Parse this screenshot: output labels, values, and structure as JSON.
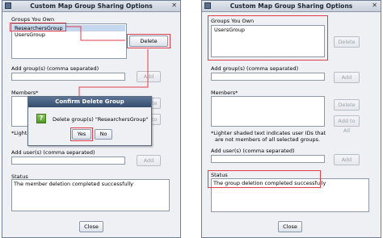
{
  "left": {
    "title": "Custom Map Group Sharing Options",
    "groups_label": "Groups You Own",
    "groups": [
      "ResearchersGroup",
      "UsersGroup"
    ],
    "delete_label": "Delete",
    "add_groups_label": "Add group(s) (comma separated)",
    "add_label": "Add",
    "members_label": "Members*",
    "delete2_label": "Delete",
    "add_to_all_label": "Add to All",
    "lighter_note_start": "*Lighter",
    "add_users_label": "Add user(s) (comma separated)",
    "add2_label": "Add",
    "status_label": "Status",
    "status_text": "The member deletion completed successfully",
    "close_label": "Close"
  },
  "dialog": {
    "title": "Confirm Delete Group",
    "message": "Delete group(s) \"ResearchersGroup\"",
    "yes_label": "Yes",
    "no_label": "No",
    "icon_glyph": "?"
  },
  "right": {
    "title": "Custom Map Group Sharing Options",
    "groups_label": "Groups You Own",
    "groups": [
      "UsersGroup"
    ],
    "delete_label": "Delete",
    "add_groups_label": "Add group(s) (comma separated)",
    "add_label": "Add",
    "members_label": "Members*",
    "delete2_label": "Delete",
    "add_to_all_label": "Add to All",
    "lighter_note_line1": "*Lighter shaded text indicates user IDs that",
    "lighter_note_line2": "are not members of all selected groups.",
    "add_users_label": "Add user(s) (comma separated)",
    "add2_label": "Add",
    "status_label": "Status",
    "status_text": "The group deletion completed successfully",
    "close_label": "Close"
  },
  "colors": {
    "highlight": "#e23c4b",
    "selection": "#c5d7ee",
    "window_bg": "#eef0f4"
  }
}
